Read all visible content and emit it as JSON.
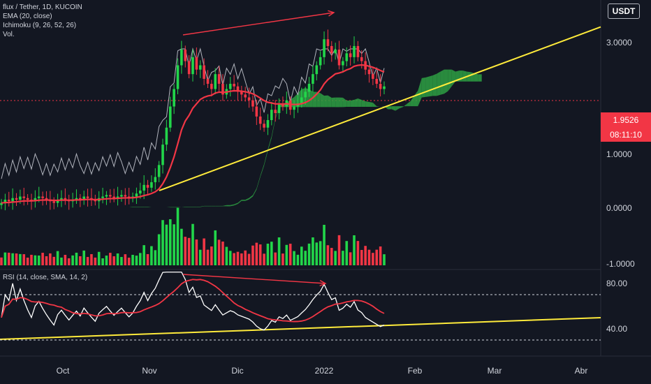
{
  "chart_data": [
    {
      "type": "candlestick",
      "title": "flux / Tether, 1D, KUCOIN",
      "indicators": [
        "EMA (20, close)",
        "Ichimoku (9, 26, 52, 26)",
        "Vol."
      ],
      "currency": "USDT",
      "y_ticks": [
        "3.0000",
        "1.0000",
        "0.0000",
        "-1.0000"
      ],
      "y_tick_values": [
        3.0,
        1.0,
        0.0,
        -1.0
      ],
      "y_scale": "log-like",
      "current_price": "1.9526",
      "countdown": "08:11:10",
      "x_ticks": [
        "Oct",
        "Nov",
        "Dic",
        "2022",
        "Feb",
        "Mar",
        "Abr"
      ],
      "colors": {
        "up": "#22d64a",
        "down": "#f23645",
        "ema": "#f23645",
        "trendline": "#ffeb3b",
        "cloud": "#2ea043",
        "annotation": "#f23645",
        "volume_line": "#b2b5be"
      },
      "close_series": [
        0.62,
        0.64,
        0.63,
        0.65,
        0.64,
        0.66,
        0.65,
        0.64,
        0.63,
        0.65,
        0.66,
        0.65,
        0.64,
        0.63,
        0.62,
        0.64,
        0.65,
        0.64,
        0.63,
        0.64,
        0.65,
        0.64,
        0.66,
        0.65,
        0.64,
        0.63,
        0.65,
        0.66,
        0.67,
        0.66,
        0.65,
        0.66,
        0.67,
        0.66,
        0.65,
        0.66,
        0.68,
        0.7,
        0.74,
        0.72,
        0.76,
        0.8,
        0.9,
        1.1,
        1.3,
        1.6,
        1.9,
        2.4,
        2.8,
        2.5,
        2.2,
        2.6,
        2.3,
        2.4,
        2.1,
        2.0,
        1.9,
        2.2,
        2.0,
        1.8,
        1.9,
        2.0,
        1.95,
        1.85,
        1.8,
        1.75,
        1.7,
        1.6,
        1.45,
        1.35,
        1.3,
        1.4,
        1.55,
        1.5,
        1.65,
        1.6,
        1.7,
        1.55,
        1.6,
        1.65,
        1.75,
        1.85,
        2.0,
        2.2,
        2.4,
        2.6,
        3.1,
        2.9,
        2.7,
        2.8,
        2.4,
        2.5,
        2.7,
        2.6,
        2.9,
        2.6,
        2.5,
        2.3,
        2.2,
        2.1,
        2.0,
        1.9,
        1.95
      ],
      "annotations": [
        {
          "type": "arrow",
          "panel": "price",
          "color": "#f23645"
        },
        {
          "type": "arrow",
          "panel": "rsi",
          "color": "#f23645"
        },
        {
          "type": "trendline",
          "panel": "price",
          "color": "#ffeb3b"
        },
        {
          "type": "trendline",
          "panel": "rsi",
          "color": "#ffeb3b"
        }
      ]
    },
    {
      "type": "line",
      "title": "RSI (14, close, SMA, 14, 2)",
      "y_ticks": [
        "80.00",
        "40.00"
      ],
      "y_tick_values": [
        80,
        40
      ],
      "bands": [
        70,
        30
      ],
      "colors": {
        "rsi": "#ffffff",
        "sma": "#f23645",
        "band": "#d1d4dc"
      }
    }
  ]
}
